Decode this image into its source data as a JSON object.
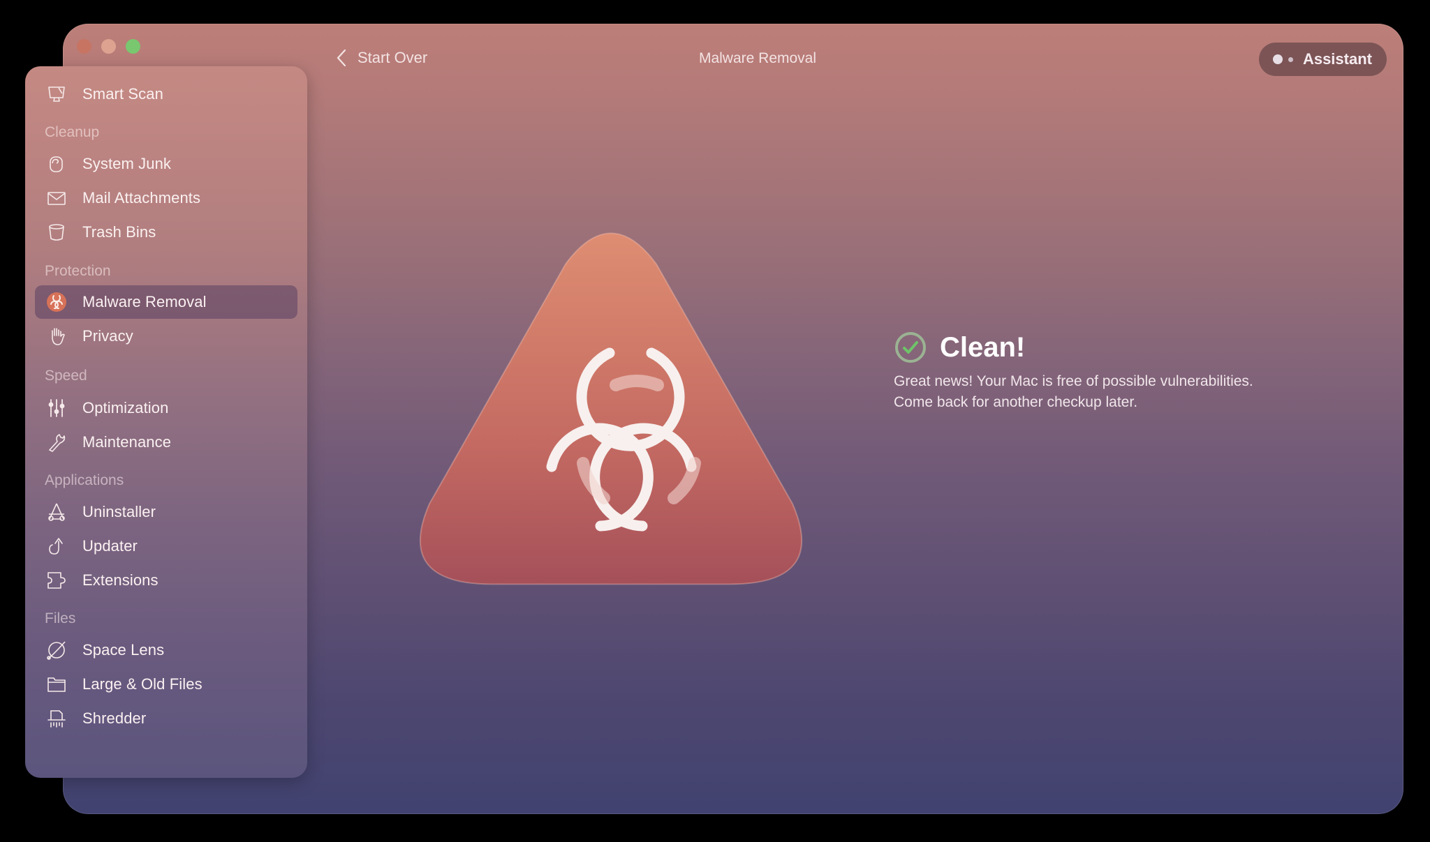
{
  "window": {
    "title": "Malware Removal",
    "traffic_lights": [
      "close",
      "minimize",
      "zoom"
    ]
  },
  "toolbar": {
    "back_label": "Start Over",
    "back_icon": "chevron-left-icon",
    "assistant_label": "Assistant",
    "assistant_icon": "assistant-dots-icon"
  },
  "sidebar": {
    "top_item": {
      "label": "Smart Scan",
      "icon": "monitor-icon"
    },
    "sections": [
      {
        "title": "Cleanup",
        "items": [
          {
            "label": "System Junk",
            "icon": "junk-icon"
          },
          {
            "label": "Mail Attachments",
            "icon": "mail-icon"
          },
          {
            "label": "Trash Bins",
            "icon": "trash-icon"
          }
        ]
      },
      {
        "title": "Protection",
        "items": [
          {
            "label": "Malware Removal",
            "icon": "biohazard-icon",
            "active": true
          },
          {
            "label": "Privacy",
            "icon": "hand-icon"
          }
        ]
      },
      {
        "title": "Speed",
        "items": [
          {
            "label": "Optimization",
            "icon": "sliders-icon"
          },
          {
            "label": "Maintenance",
            "icon": "wrench-icon"
          }
        ]
      },
      {
        "title": "Applications",
        "items": [
          {
            "label": "Uninstaller",
            "icon": "app-uninstall-icon"
          },
          {
            "label": "Updater",
            "icon": "update-arrow-icon"
          },
          {
            "label": "Extensions",
            "icon": "puzzle-icon"
          }
        ]
      },
      {
        "title": "Files",
        "items": [
          {
            "label": "Space Lens",
            "icon": "planet-icon"
          },
          {
            "label": "Large & Old Files",
            "icon": "folder-icon"
          },
          {
            "label": "Shredder",
            "icon": "shredder-icon"
          }
        ]
      }
    ]
  },
  "main": {
    "hero_icon": "biohazard-triangle-icon",
    "status_icon": "check-circle-icon",
    "status_title": "Clean!",
    "status_line1": "Great news! Your Mac is free of possible vulnerabilities.",
    "status_line2": "Come back for another checkup later."
  },
  "colors": {
    "accent_check": "#6fc46a",
    "active_item_bg": "#5a4060",
    "hero_top": "#de8d72",
    "hero_bottom": "#a5505a"
  }
}
